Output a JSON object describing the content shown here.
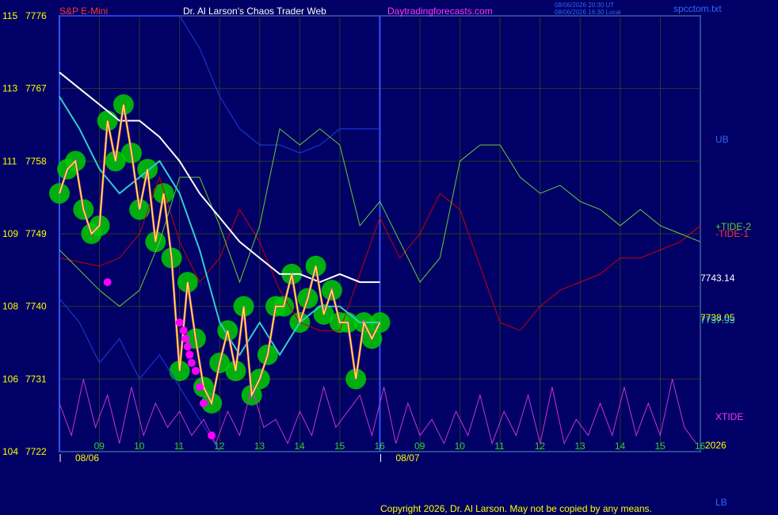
{
  "header": {
    "symbol": "S&P E-Mini",
    "title": "Dr. Al Larson's Chaos Trader Web",
    "site": "Daytradingforecasts.com",
    "timestamp_ut": "08/06/2026 20:30 UT",
    "timestamp_local": "08/06/2026 16:30 Local",
    "file": "spcctom.txt"
  },
  "footer": {
    "copyright": "Copyright 2026, Dr. Al Larson. May not be copied by any means."
  },
  "colors": {
    "background": "#000066",
    "grid": "#2a3a2a",
    "price": "#ffff00",
    "price_fill": "#00cc00",
    "ma_fast": "#33cccc",
    "ma_slow": "#ffffff",
    "tide1": "#cc0000",
    "tide2": "#66cc33",
    "band": "#1a33cc",
    "xtide": "#cc33cc",
    "dots": "#ff00ff"
  },
  "chart_data": {
    "type": "line",
    "title": "Dr. Al Larson's Chaos Trader Web",
    "symbol": "S&P E-Mini",
    "ylim": [
      7722,
      7776
    ],
    "y_ticks": [
      {
        "left": "115",
        "right": "7776",
        "value": 7776
      },
      {
        "left": "113",
        "right": "7767",
        "value": 7767
      },
      {
        "left": "111",
        "right": "7758",
        "value": 7758
      },
      {
        "left": "109",
        "right": "7749",
        "value": 7749
      },
      {
        "left": "108",
        "right": "7740",
        "value": 7740
      },
      {
        "left": "106",
        "right": "7731",
        "value": 7731
      },
      {
        "left": "104",
        "right": "7722",
        "value": 7722
      }
    ],
    "x_ticks": [
      "09",
      "10",
      "11",
      "12",
      "13",
      "14",
      "15",
      "16",
      "09",
      "10",
      "11",
      "12",
      "13",
      "14",
      "15",
      "16"
    ],
    "date_labels": [
      "08/06",
      "08/07"
    ],
    "year_label": "2026",
    "xlim": [
      0,
      16
    ],
    "divider_x": 8,
    "right_labels": {
      "ub": "UB",
      "lb": "LB",
      "tide2": "+TIDE-2",
      "tide1": "-TIDE-1",
      "xtide": "XTIDE",
      "value_top": "7743.14",
      "value_mid1": "7738.05",
      "value_mid2": "7737.95"
    },
    "series": [
      {
        "name": "price",
        "x": [
          0,
          0.2,
          0.4,
          0.6,
          0.8,
          1,
          1.2,
          1.4,
          1.6,
          1.8,
          2,
          2.2,
          2.4,
          2.6,
          2.8,
          3,
          3.2,
          3.4,
          3.6,
          3.8,
          4,
          4.2,
          4.4,
          4.6,
          4.8,
          5,
          5.2,
          5.4,
          5.6,
          5.8,
          6,
          6.2,
          6.4,
          6.6,
          6.8,
          7,
          7.2,
          7.4,
          7.6,
          7.8,
          8
        ],
        "values": [
          7754,
          7757,
          7758,
          7752,
          7749,
          7750,
          7763,
          7758,
          7765,
          7759,
          7752,
          7757,
          7748,
          7754,
          7746,
          7732,
          7743,
          7736,
          7730,
          7728,
          7733,
          7737,
          7732,
          7740,
          7729,
          7731,
          7734,
          7740,
          7740,
          7744,
          7738,
          7741,
          7745,
          7739,
          7742,
          7738,
          7738,
          7731,
          7738,
          7736,
          7738
        ]
      },
      {
        "name": "ma_fast",
        "x": [
          0,
          0.5,
          1,
          1.5,
          2,
          2.5,
          3,
          3.5,
          4,
          4.5,
          5,
          5.5,
          6,
          6.5,
          7,
          7.5,
          8
        ],
        "values": [
          7766,
          7762,
          7757,
          7754,
          7756,
          7758,
          7754,
          7747,
          7738,
          7734,
          7738,
          7734,
          7738,
          7740,
          7740,
          7738,
          7738
        ]
      },
      {
        "name": "ma_slow",
        "x": [
          0,
          0.5,
          1,
          1.5,
          2,
          2.5,
          3,
          3.5,
          4,
          4.5,
          5,
          5.5,
          6,
          6.5,
          7,
          7.5,
          8
        ],
        "values": [
          7769,
          7767,
          7765,
          7763,
          7763,
          7761,
          7758,
          7754,
          7751,
          7748,
          7746,
          7744,
          7744,
          7743,
          7744,
          7743,
          7743
        ]
      },
      {
        "name": "-TIDE-1",
        "x": [
          0,
          1,
          1.5,
          2,
          2.5,
          3,
          3.5,
          4,
          4.5,
          5,
          5.5,
          6,
          6.5,
          7,
          7.5,
          8,
          8.5,
          9,
          9.5,
          10,
          10.5,
          11,
          11.5,
          12,
          12.5,
          13,
          13.5,
          14,
          14.5,
          15,
          15.5,
          16
        ],
        "values": [
          7746,
          7745,
          7746,
          7749,
          7756,
          7748,
          7743,
          7746,
          7752,
          7748,
          7742,
          7738,
          7737,
          7737,
          7744,
          7751,
          7746,
          7749,
          7754,
          7752,
          7745,
          7738,
          7737,
          7740,
          7742,
          7743,
          7744,
          7746,
          7746,
          7747,
          7748,
          7750
        ]
      },
      {
        "name": "+TIDE-2",
        "x": [
          0,
          1,
          1.5,
          2,
          2.5,
          3,
          3.5,
          4,
          4.5,
          5,
          5.5,
          6,
          6.5,
          7,
          7.5,
          8,
          8.5,
          9,
          9.5,
          10,
          10.5,
          11,
          11.5,
          12,
          12.5,
          13,
          13.5,
          14,
          14.5,
          15,
          15.5,
          16
        ],
        "values": [
          7747,
          7742,
          7740,
          7742,
          7748,
          7756,
          7756,
          7750,
          7743,
          7750,
          7762,
          7760,
          7762,
          7760,
          7750,
          7753,
          7748,
          7743,
          7746,
          7758,
          7760,
          7760,
          7756,
          7754,
          7755,
          7753,
          7752,
          7750,
          7752,
          7750,
          7749,
          7748
        ]
      },
      {
        "name": "UB",
        "x": [
          0,
          1,
          2,
          3,
          3.5,
          4,
          4.5,
          5,
          5.5,
          6,
          6.5,
          7,
          7.5,
          8
        ],
        "values": [
          7776,
          7776,
          7776,
          7776,
          7772,
          7766,
          7762,
          7760,
          7760,
          7759,
          7760,
          7762,
          7762,
          7762
        ]
      },
      {
        "name": "LB",
        "x": [
          0,
          0.5,
          1,
          1.5,
          2,
          2.5,
          3,
          3.5,
          4
        ],
        "values": [
          7741,
          7738,
          7733,
          7736,
          7731,
          7734,
          7730,
          7726,
          7722
        ]
      },
      {
        "name": "XTIDE",
        "x": [
          0,
          0.3,
          0.6,
          0.9,
          1.2,
          1.5,
          1.8,
          2.1,
          2.4,
          2.7,
          3,
          3.3,
          3.6,
          3.9,
          4.2,
          4.5,
          4.8,
          5.1,
          5.4,
          5.7,
          6,
          6.3,
          6.6,
          6.9,
          7.2,
          7.5,
          7.8,
          8.1,
          8.4,
          8.7,
          9,
          9.3,
          9.6,
          9.9,
          10.2,
          10.5,
          10.8,
          11.1,
          11.4,
          11.7,
          12,
          12.3,
          12.6,
          12.9,
          13.2,
          13.5,
          13.8,
          14.1,
          14.4,
          14.7,
          15,
          15.3,
          15.6,
          15.9
        ],
        "values": [
          7728,
          7724,
          7731,
          7725,
          7729,
          7723,
          7730,
          7724,
          7728,
          7725,
          7727,
          7724,
          7726,
          7723,
          7727,
          7724,
          7730,
          7725,
          7726,
          7723,
          7727,
          7724,
          7730,
          7725,
          7727,
          7729,
          7724,
          7730,
          7723,
          7728,
          7724,
          7726,
          7723,
          7727,
          7724,
          7729,
          7723,
          7727,
          7724,
          7729,
          7723,
          7730,
          7723,
          7726,
          7724,
          7728,
          7724,
          7730,
          7724,
          7728,
          7724,
          7731,
          7725,
          7723
        ]
      },
      {
        "name": "dots",
        "x": [
          1.2,
          3.0,
          3.1,
          3.15,
          3.2,
          3.25,
          3.3,
          3.4,
          3.5,
          3.6,
          3.8
        ],
        "values": [
          7743,
          7738,
          7737,
          7736,
          7735,
          7734,
          7733,
          7732,
          7730,
          7728,
          7724
        ]
      }
    ]
  }
}
